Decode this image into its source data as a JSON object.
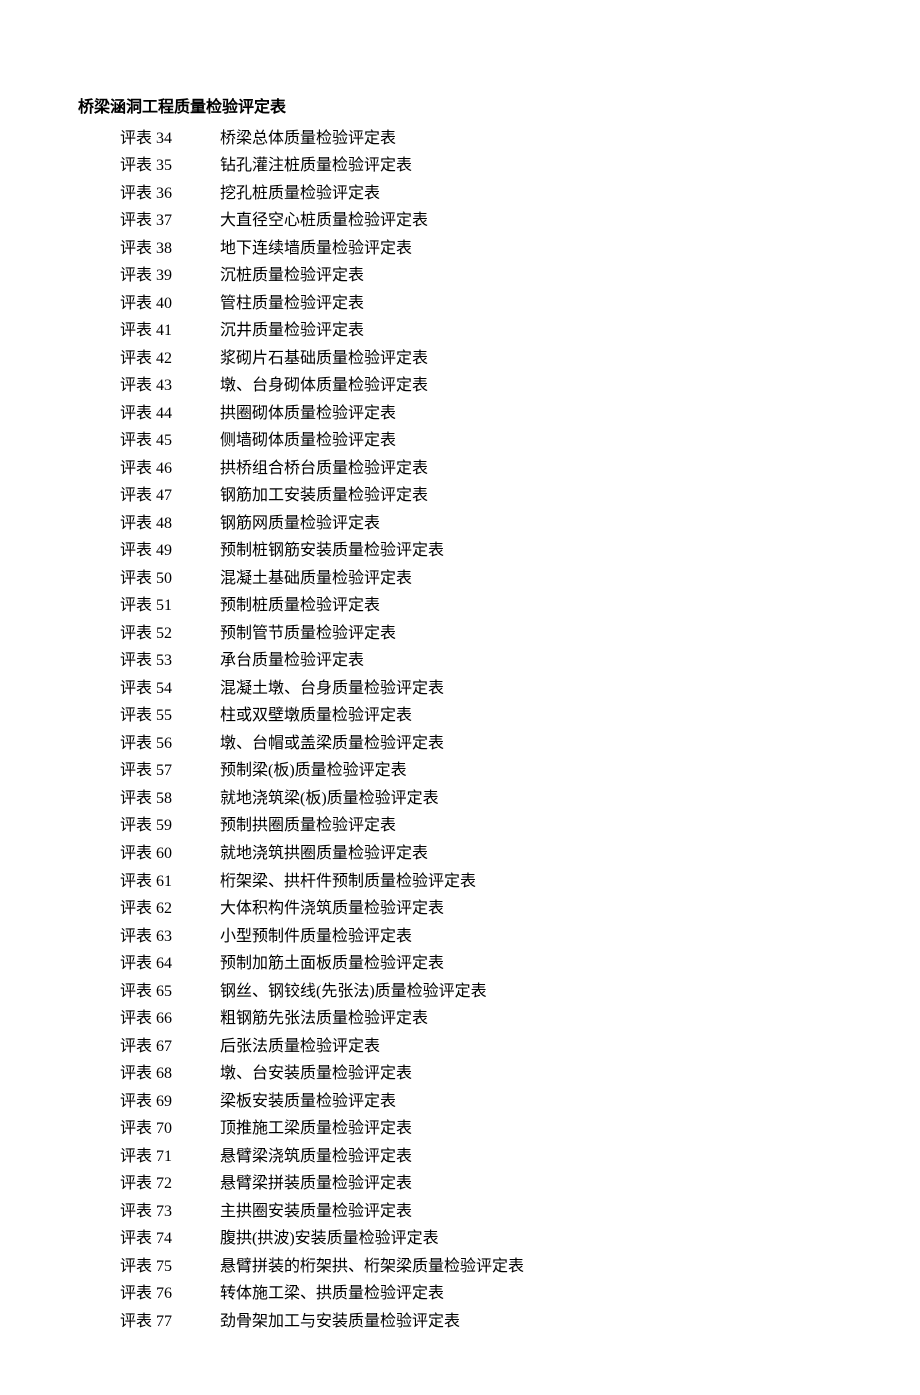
{
  "title": "桥梁涵洞工程质量检验评定表",
  "items": [
    {
      "key": "评表 34",
      "desc": "桥梁总体质量检验评定表"
    },
    {
      "key": "评表 35",
      "desc": "钻孔灌注桩质量检验评定表"
    },
    {
      "key": "评表 36",
      "desc": "挖孔桩质量检验评定表"
    },
    {
      "key": "评表 37",
      "desc": "大直径空心桩质量检验评定表"
    },
    {
      "key": "评表 38",
      "desc": "地下连续墙质量检验评定表"
    },
    {
      "key": "评表 39",
      "desc": "沉桩质量检验评定表"
    },
    {
      "key": "评表 40",
      "desc": "管柱质量检验评定表"
    },
    {
      "key": "评表 41",
      "desc": "沉井质量检验评定表"
    },
    {
      "key": "评表 42",
      "desc": "浆砌片石基础质量检验评定表"
    },
    {
      "key": "评表 43",
      "desc": "墩、台身砌体质量检验评定表"
    },
    {
      "key": "评表 44",
      "desc": "拱圈砌体质量检验评定表"
    },
    {
      "key": "评表 45",
      "desc": "侧墙砌体质量检验评定表"
    },
    {
      "key": "评表 46",
      "desc": "拱桥组合桥台质量检验评定表"
    },
    {
      "key": "评表 47",
      "desc": "钢筋加工安装质量检验评定表"
    },
    {
      "key": "评表 48",
      "desc": "钢筋网质量检验评定表"
    },
    {
      "key": "评表 49",
      "desc": "预制桩钢筋安装质量检验评定表"
    },
    {
      "key": "评表 50",
      "desc": "混凝土基础质量检验评定表"
    },
    {
      "key": "评表 51",
      "desc": "预制桩质量检验评定表"
    },
    {
      "key": "评表 52",
      "desc": "预制管节质量检验评定表"
    },
    {
      "key": "评表 53",
      "desc": "承台质量检验评定表"
    },
    {
      "key": "评表 54",
      "desc": "混凝土墩、台身质量检验评定表"
    },
    {
      "key": "评表 55",
      "desc": "柱或双壁墩质量检验评定表"
    },
    {
      "key": "评表 56",
      "desc": "墩、台帽或盖梁质量检验评定表"
    },
    {
      "key": "评表 57",
      "desc": "预制梁(板)质量检验评定表"
    },
    {
      "key": "评表 58",
      "desc": "就地浇筑梁(板)质量检验评定表"
    },
    {
      "key": "评表 59",
      "desc": "预制拱圈质量检验评定表"
    },
    {
      "key": "评表 60",
      "desc": "就地浇筑拱圈质量检验评定表"
    },
    {
      "key": "评表 61",
      "desc": "桁架梁、拱杆件预制质量检验评定表"
    },
    {
      "key": "评表 62",
      "desc": "大体积构件浇筑质量检验评定表"
    },
    {
      "key": "评表 63",
      "desc": "小型预制件质量检验评定表"
    },
    {
      "key": "评表 64",
      "desc": "预制加筋土面板质量检验评定表"
    },
    {
      "key": "评表 65",
      "desc": "钢丝、钢铰线(先张法)质量检验评定表"
    },
    {
      "key": "评表 66",
      "desc": "粗钢筋先张法质量检验评定表"
    },
    {
      "key": "评表 67",
      "desc": "后张法质量检验评定表"
    },
    {
      "key": "评表 68",
      "desc": "墩、台安装质量检验评定表"
    },
    {
      "key": "评表 69",
      "desc": "梁板安装质量检验评定表"
    },
    {
      "key": "评表 70",
      "desc": "顶推施工梁质量检验评定表"
    },
    {
      "key": "评表 71",
      "desc": "悬臂梁浇筑质量检验评定表"
    },
    {
      "key": "评表 72",
      "desc": "悬臂梁拼装质量检验评定表"
    },
    {
      "key": "评表 73",
      "desc": "主拱圈安装质量检验评定表"
    },
    {
      "key": "评表 74",
      "desc": "腹拱(拱波)安装质量检验评定表"
    },
    {
      "key": "评表 75",
      "desc": "悬臂拼装的桁架拱、桁架梁质量检验评定表"
    },
    {
      "key": "评表 76",
      "desc": "转体施工梁、拱质量检验评定表"
    },
    {
      "key": "评表 77",
      "desc": "劲骨架加工与安装质量检验评定表"
    }
  ]
}
